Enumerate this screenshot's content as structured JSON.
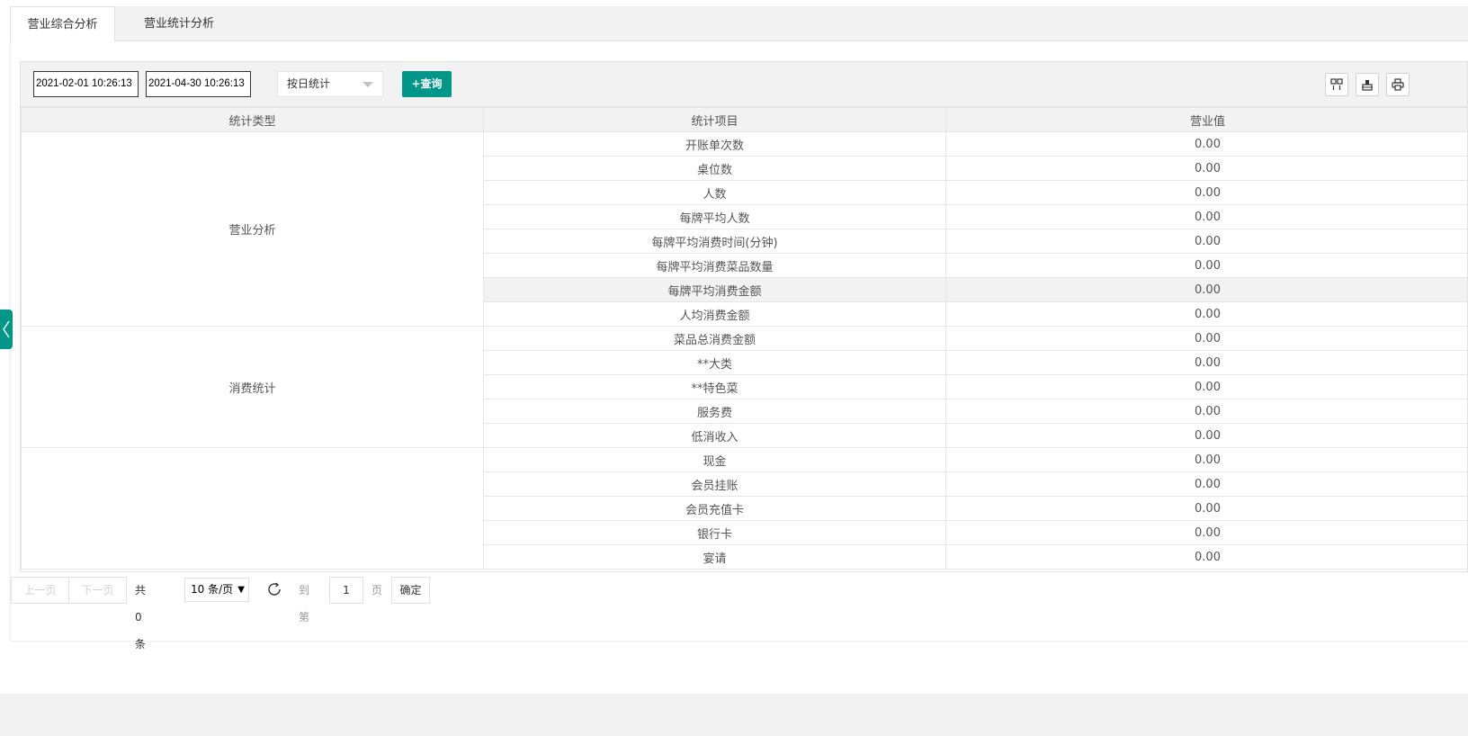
{
  "tabs": [
    {
      "label": "营业综合分析"
    },
    {
      "label": "营业统计分析"
    }
  ],
  "toolbar": {
    "start_date": "2021-02-01 10:26:13",
    "end_date": "2021-04-30 10:26:13",
    "group_by": "按日统计",
    "query_label": "+查询"
  },
  "table": {
    "columns": [
      "统计类型",
      "统计项目",
      "营业值"
    ],
    "groups": [
      {
        "type": "营业分析",
        "rows": [
          {
            "item": "开账单次数",
            "value": "0.00"
          },
          {
            "item": "桌位数",
            "value": "0.00"
          },
          {
            "item": "人数",
            "value": "0.00"
          },
          {
            "item": "每牌平均人数",
            "value": "0.00"
          },
          {
            "item": "每牌平均消费时间(分钟)",
            "value": "0.00"
          },
          {
            "item": "每牌平均消费菜品数量",
            "value": "0.00"
          },
          {
            "item": "每牌平均消费金额",
            "value": "0.00"
          },
          {
            "item": "人均消费金额",
            "value": "0.00"
          }
        ]
      },
      {
        "type": "消费统计",
        "rows": [
          {
            "item": "菜品总消费金额",
            "value": "0.00"
          },
          {
            "item": "**大类",
            "value": "0.00"
          },
          {
            "item": "**特色菜",
            "value": "0.00"
          },
          {
            "item": "服务费",
            "value": "0.00"
          },
          {
            "item": "低消收入",
            "value": "0.00"
          }
        ]
      },
      {
        "type": "",
        "rows": [
          {
            "item": "现金",
            "value": "0.00"
          },
          {
            "item": "会员挂账",
            "value": "0.00"
          },
          {
            "item": "会员充值卡",
            "value": "0.00"
          },
          {
            "item": "银行卡",
            "value": "0.00"
          },
          {
            "item": "宴请",
            "value": "0.00"
          }
        ]
      }
    ]
  },
  "pager": {
    "prev": "上一页",
    "next": "下一页",
    "total": "共 0 条",
    "page_size": "10 条/页",
    "goto": "到第",
    "page": "1",
    "page_unit": "页",
    "confirm": "确定"
  },
  "colors": {
    "accent": "#009688",
    "header_bg": "#f2f2f2",
    "border": "#e6e6e6"
  }
}
